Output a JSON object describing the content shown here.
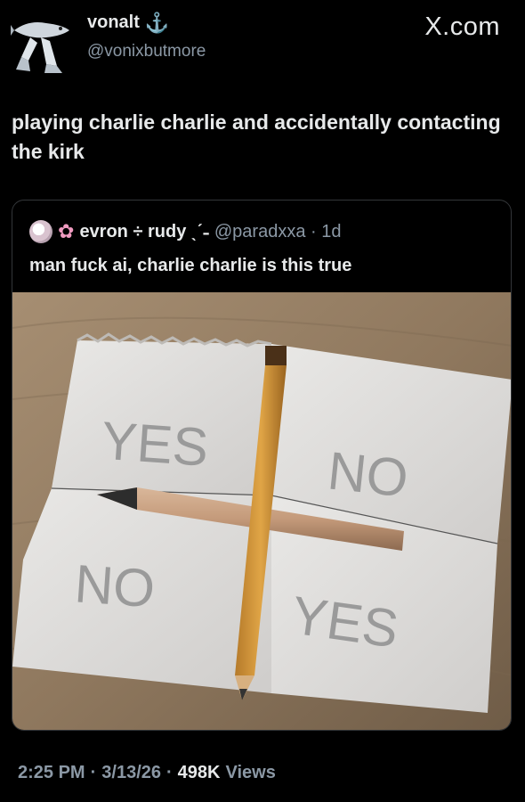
{
  "header": {
    "display_name": "vonalt",
    "name_icon": "anchor-icon",
    "handle": "@vonixbutmore",
    "brand": "X.com"
  },
  "tweet": {
    "text": "playing charlie charlie and accidentally contacting the kirk"
  },
  "quote": {
    "display_name": "evron ÷ rudy ˎˊ˗",
    "handle_meta": "@paradxxa · 1d",
    "text": "man fuck ai, charlie charlie is this true",
    "photo": {
      "quadrants": [
        "YES",
        "NO",
        "NO",
        "YES"
      ]
    }
  },
  "footer": {
    "time": "2:25 PM",
    "sep1": "·",
    "date": "3/13/26",
    "sep2": "·",
    "views_count": "498K",
    "views_label": "Views"
  }
}
